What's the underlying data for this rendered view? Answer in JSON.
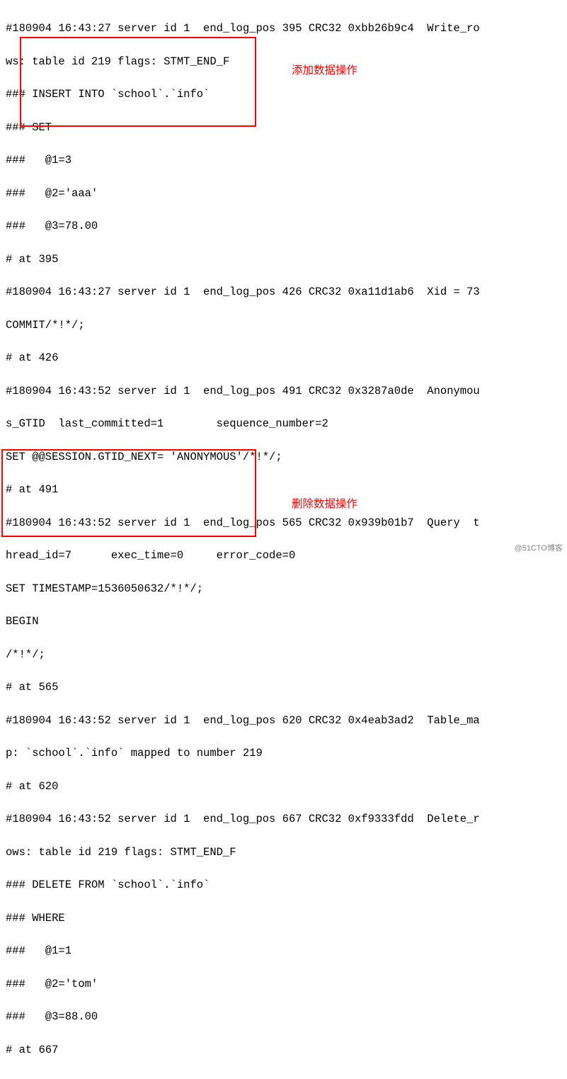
{
  "lines": {
    "l1": "#180904 16:43:27 server id 1  end_log_pos 395 CRC32 0xbb26b9c4  Write_ro",
    "l2": "ws: table id 219 flags: STMT_END_F",
    "l3": "### INSERT INTO `school`.`info`",
    "l4": "### SET",
    "l5": "###   @1=3",
    "l6": "###   @2='aaa'",
    "l7": "###   @3=78.00",
    "l8": "# at 395",
    "l9": "#180904 16:43:27 server id 1  end_log_pos 426 CRC32 0xa11d1ab6  Xid = 73",
    "l10": "COMMIT/*!*/;",
    "l11": "# at 426",
    "l12": "#180904 16:43:52 server id 1  end_log_pos 491 CRC32 0x3287a0de  Anonymou",
    "l13": "s_GTID  last_committed=1        sequence_number=2",
    "l14": "SET @@SESSION.GTID_NEXT= 'ANONYMOUS'/*!*/;",
    "l15": "# at 491",
    "l16": "#180904 16:43:52 server id 1  end_log_pos 565 CRC32 0x939b01b7  Query  t",
    "l17": "hread_id=7      exec_time=0     error_code=0",
    "l18": "SET TIMESTAMP=1536050632/*!*/;",
    "l19": "BEGIN",
    "l20": "/*!*/;",
    "l21": "# at 565",
    "l22": "#180904 16:43:52 server id 1  end_log_pos 620 CRC32 0x4eab3ad2  Table_ma",
    "l23": "p: `school`.`info` mapped to number 219",
    "l24": "# at 620",
    "l25": "#180904 16:43:52 server id 1  end_log_pos 667 CRC32 0xf9333fdd  Delete_r",
    "l26": "ows: table id 219 flags: STMT_END_F",
    "l27": "### DELETE FROM `school`.`info`",
    "l28": "### WHERE",
    "l29": "###   @1=1",
    "l30": "###   @2='tom'",
    "l31": "###   @3=88.00",
    "l32": "# at 667"
  },
  "annotations": {
    "insert_label": "添加数据操作",
    "delete_label": "删除数据操作"
  },
  "watermark": "@51CTO博客"
}
